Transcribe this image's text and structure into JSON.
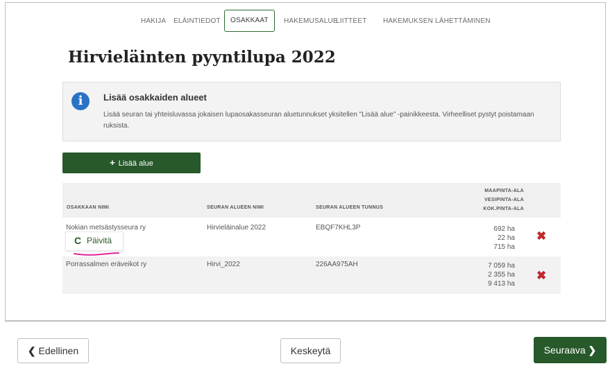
{
  "tabs": {
    "hakija": "HAKIJA",
    "elaintiedot": "ELÄINTIEDOT",
    "osakkaat": "OSAKKAAT",
    "hakemusalue": "HAKEMUSALUE",
    "liitteet": "LIITTEET",
    "lahettaminen": "HAKEMUKSEN LÄHETTÄMINEN",
    "active": "OSAKKAAT"
  },
  "page": {
    "title": "Hirvieläinten pyyntilupa 2022"
  },
  "info": {
    "icon": "info-icon",
    "title": "Lisää osakkaiden alueet",
    "text": "Lisää seuran tai yhteisluvassa jokaisen lupaosakasseuran aluetunnukset yksitellen \"Lisää alue\" -painikkeesta. Virheelliset pystyt poistamaan ruksista."
  },
  "add_button": {
    "icon": "plus-icon",
    "label": "Lisää alue"
  },
  "table": {
    "headers": {
      "owner": "OSAKKAAN NIMI",
      "area_name": "SEURAN ALUEEN NIMI",
      "area_id": "SEURAN ALUEEN TUNNUS",
      "land": "MAAPINTA-ALA",
      "water": "VESIPINTA-ALA",
      "total": "KOK.PINTA-ALA"
    },
    "rows": [
      {
        "owner": "Nokian metsästysseura ry",
        "area_name": "Hirvieläinalue 2022",
        "area_id": "EBQF7KHL3P",
        "land": "692 ha",
        "water": "22 ha",
        "total": "715 ha",
        "refresh_label": "Päivitä"
      },
      {
        "owner": "Porrassalmen eräveikot ry",
        "area_name": "Hirvi_2022",
        "area_id": "226AA975AH",
        "land": "7 059 ha",
        "water": "2 355 ha",
        "total": "9 413 ha"
      }
    ],
    "delete_symbol": "✖",
    "refresh_symbol": "C"
  },
  "footer": {
    "prev_label": "Edellinen",
    "prev_chevron": "❮",
    "cancel_label": "Keskeytä",
    "next_label": "Seuraava",
    "next_chevron": "❯"
  },
  "colors": {
    "primary_green": "#27592a",
    "info_blue": "#2a73c4",
    "delete_red": "#c0282d",
    "highlight_magenta": "#e0239b"
  }
}
